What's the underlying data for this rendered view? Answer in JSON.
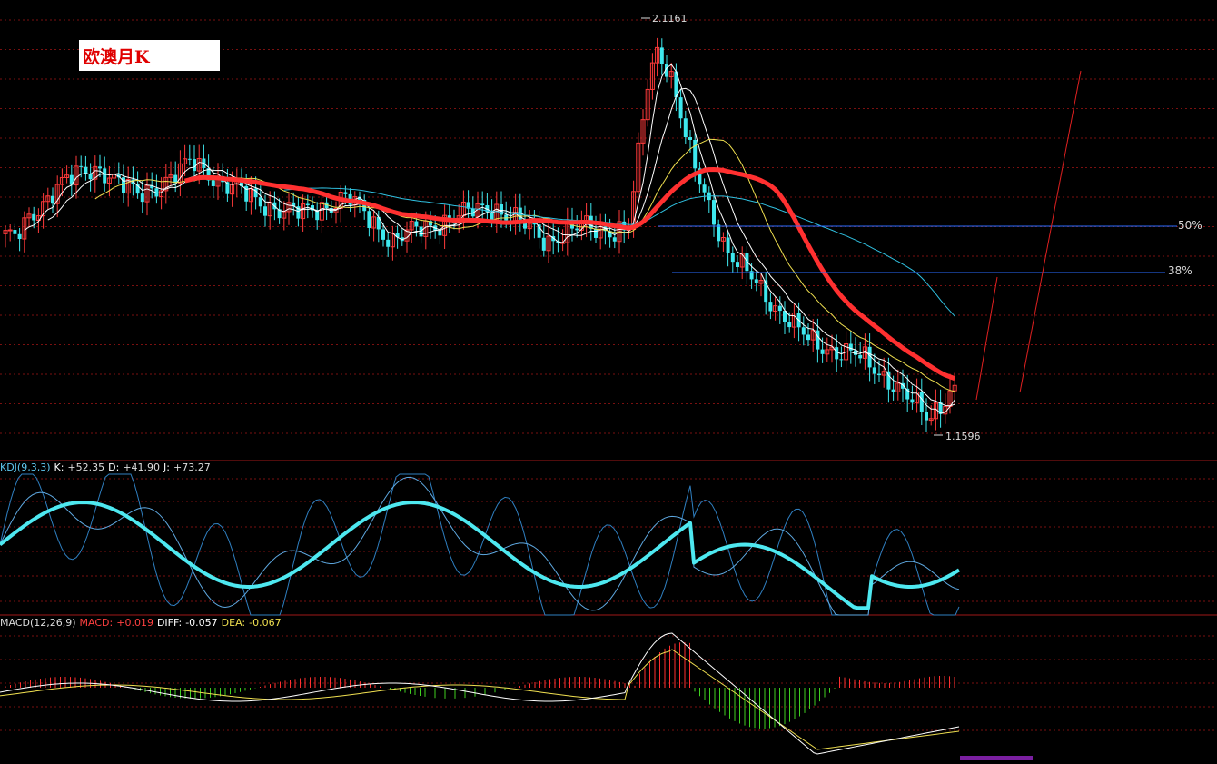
{
  "title": "欧澳月K",
  "colors": {
    "up": "#ff3a3a",
    "down": "#3ee8ee",
    "ma_thick": "#ff3030",
    "ma_white": "#ffffff",
    "ma_yellow": "#f0e050",
    "ma_cyan": "#30c0e0",
    "fib_line": "#2a6cff",
    "grid": "#7a1010",
    "kdj": "#5ec8f0",
    "macd_pos": "#ff3030",
    "macd_neg": "#40d020"
  },
  "main_chart": {
    "high_label": "2.1161",
    "low_label": "1.1596",
    "fib_50_label": "50%",
    "fib_38_label": "38%"
  },
  "kdj": {
    "name": "KDJ(9,3,3)",
    "k_label": "K:",
    "k_value": "+52.35",
    "d_label": "D:",
    "d_value": "+41.90",
    "j_label": "J:",
    "j_value": "+73.27"
  },
  "macd": {
    "name": "MACD(12,26,9)",
    "macd_label": "MACD:",
    "macd_value": "+0.019",
    "diff_label": "DIFF:",
    "diff_value": "-0.057",
    "dea_label": "DEA:",
    "dea_value": "-0.067"
  },
  "chart_data": {
    "type": "candlestick",
    "series": [
      {
        "name": "price",
        "monthly_closes_estimated": [
          1.62,
          1.6,
          1.7,
          1.75,
          1.78,
          1.68,
          1.72,
          1.7,
          1.66,
          1.62,
          1.6,
          1.62,
          1.6,
          1.61,
          1.62,
          1.61,
          1.62,
          1.63,
          1.62,
          2.02,
          1.78,
          1.62,
          1.48,
          1.4,
          1.36,
          1.34,
          1.31,
          1.26,
          1.19,
          1.26
        ]
      }
    ],
    "price_high": 2.1161,
    "price_low": 1.1596,
    "fib_levels": [
      "50%",
      "38%"
    ],
    "kdj": {
      "K": 52.35,
      "D": 41.9,
      "J": 73.27
    },
    "macd": {
      "MACD": 0.019,
      "DIFF": -0.057,
      "DEA": -0.067
    }
  }
}
